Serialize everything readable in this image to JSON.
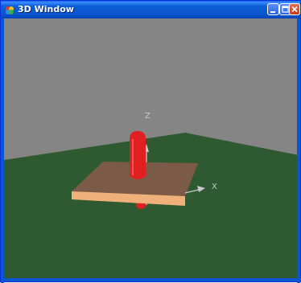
{
  "window": {
    "title": "3D Window"
  },
  "scene": {
    "axis_labels": {
      "x": "X",
      "z": "Z"
    },
    "colors": {
      "sky": "#858585",
      "ground": "#2f5a31",
      "platform_top": "#7c5a48",
      "platform_front": "#f0b07a",
      "cylinder": "#e02020",
      "axis": "#c8c8c8"
    }
  }
}
